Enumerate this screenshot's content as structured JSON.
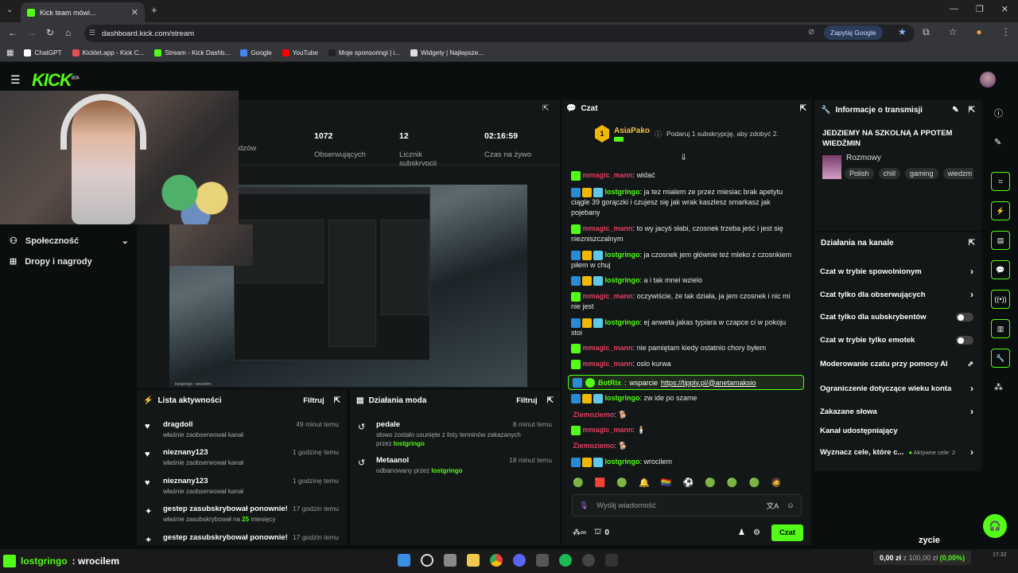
{
  "browser": {
    "tab_title": "Kick team mówi...",
    "url": "dashboard.kick.com/stream",
    "ask_google": "Zapytaj Google",
    "bookmarks": [
      {
        "label": "ChatGPT",
        "color": "#ffffff"
      },
      {
        "label": "Kicklet.app - Kick C...",
        "color": "#e05050"
      },
      {
        "label": "Stream - Kick Dashb...",
        "color": "#53fc18"
      },
      {
        "label": "Google",
        "color": "#4285f4"
      },
      {
        "label": "YouTube",
        "color": "#ff0000"
      },
      {
        "label": "Moje sponsoringi | i...",
        "color": "#222222"
      },
      {
        "label": "Widgety | Najlepsze...",
        "color": "#dddddd"
      }
    ]
  },
  "header": {
    "logo": "KICK",
    "logo_beta": "BETA"
  },
  "sidebar": {
    "items": [
      {
        "label": "Społeczność",
        "icon": "community-icon"
      },
      {
        "label": "Dropy i nagrody",
        "icon": "gift-icon"
      }
    ]
  },
  "stats": [
    {
      "value": "",
      "label": "dzów"
    },
    {
      "value": "1072",
      "label": "Obserwujących"
    },
    {
      "value": "12",
      "label": "Licznik subskrypcji"
    },
    {
      "value": "02:16:59",
      "label": "Czas na żywo"
    }
  ],
  "preview": {
    "caption": "lostgringo : wrocilem"
  },
  "activity": {
    "title": "Lista aktywności",
    "filter": "Filtruj",
    "items": [
      {
        "icon": "heart-icon",
        "name": "dragdoll",
        "time": "49 minut temu",
        "desc": "właśnie zaobserwował kanał",
        "highlight": "",
        "desc_after": ""
      },
      {
        "icon": "heart-icon",
        "name": "nieznany123",
        "time": "1 godzinę temu",
        "desc": "właśnie zaobserwował kanał",
        "highlight": "",
        "desc_after": ""
      },
      {
        "icon": "heart-icon",
        "name": "nieznany123",
        "time": "1 godzinę temu",
        "desc": "właśnie zaobserwował kanał",
        "highlight": "",
        "desc_after": ""
      },
      {
        "icon": "sparkle-icon",
        "name": "gestep zasubskrybował ponownie!",
        "time": "17 godzin temu",
        "desc": "właśnie zasubskrybował na",
        "highlight": "25",
        "desc_after": "miesięcy"
      },
      {
        "icon": "sparkle-icon",
        "name": "gestep zasubskrybował ponownie!",
        "time": "17 godzin temu",
        "desc": "",
        "highlight": "",
        "desc_after": ""
      }
    ]
  },
  "mod": {
    "title": "Działania moda",
    "filter": "Filtruj",
    "items": [
      {
        "name": "pedale",
        "time": "8 minut temu",
        "desc": "słowo zostało usunięte z listy terminów zakazanych",
        "desc2": "przez",
        "by": "lostgringo"
      },
      {
        "name": "Metaanol",
        "time": "18 minut temu",
        "desc": "odbanowany przez",
        "desc2": "",
        "by": "lostgringo"
      }
    ]
  },
  "chat": {
    "title": "Czat",
    "pinned_name": "AsiaPako",
    "pinned_level": "1",
    "pinned_text": "Podaruj 1 subskrypcję, aby zdobyć 2.",
    "messages": [
      {
        "user": "mmagic_mann",
        "color": "#e04060",
        "badges": [
          "#53fc18"
        ],
        "text": "widać"
      },
      {
        "user": "lostgringo",
        "color": "#53fc18",
        "badges": [
          "#2a8ad4",
          "#f2b705",
          "#5ec8e8"
        ],
        "text": "ja tez mialem ze przez miesiac brak apetytu ciągle 39 gorączki i czujesz się jak wrak kaszlesz smarkasz jak pojebany"
      },
      {
        "user": "mmagic_mann",
        "color": "#e04060",
        "badges": [
          "#53fc18"
        ],
        "text": "to wy jacyś słabi, czosnek trzeba jeść i jest się niezniszczalnym"
      },
      {
        "user": "lostgringo",
        "color": "#53fc18",
        "badges": [
          "#2a8ad4",
          "#f2b705",
          "#5ec8e8"
        ],
        "text": "ja czosnek jem głównie też mleko z czosnkiem piłem w chuj"
      },
      {
        "user": "lostgringo",
        "color": "#53fc18",
        "badges": [
          "#2a8ad4",
          "#f2b705",
          "#5ec8e8"
        ],
        "text": "a i tak mnei wzielo"
      },
      {
        "user": "mmagic_mann",
        "color": "#e04060",
        "badges": [
          "#53fc18"
        ],
        "text": "oczywiście, że tak działa, ja jem czosnek i nic mi nie jest"
      },
      {
        "user": "lostgringo",
        "color": "#53fc18",
        "badges": [
          "#2a8ad4",
          "#f2b705",
          "#5ec8e8"
        ],
        "text": "ej anweta jakas typiara w czapce ci w pokoju stoi"
      },
      {
        "user": "mmagic_mann",
        "color": "#e04060",
        "badges": [
          "#53fc18"
        ],
        "text": "nie pamiętam kiedy ostatnio chory byłem"
      },
      {
        "user": "mmagic_mann",
        "color": "#e04060",
        "badges": [
          "#53fc18"
        ],
        "text": "oslo kurwa"
      }
    ],
    "bot": {
      "user": "BotRix",
      "text": "wsparcie",
      "link": "https://tipply.pl/@anetamaksio"
    },
    "messages2": [
      {
        "user": "lostgringo",
        "color": "#53fc18",
        "badges": [
          "#2a8ad4",
          "#f2b705",
          "#5ec8e8"
        ],
        "text": "zw ide po szame"
      },
      {
        "user": "Ziemoziemo",
        "color": "#e04060",
        "badges": [],
        "text": "🐕"
      },
      {
        "user": "mmagic_mann",
        "color": "#e04060",
        "badges": [
          "#53fc18"
        ],
        "text": "🕯️"
      },
      {
        "user": "Ziemoziemo",
        "color": "#e04060",
        "badges": [],
        "text": "🐕"
      },
      {
        "user": "lostgringo",
        "color": "#53fc18",
        "badges": [
          "#2a8ad4",
          "#f2b705",
          "#5ec8e8"
        ],
        "text": "wrocilem"
      }
    ],
    "emotes": [
      "🟢",
      "🟥",
      "🟢",
      "🔔",
      "🏳️‍🌈",
      "⚽",
      "🟢",
      "🟢",
      "🟢",
      "🧔"
    ],
    "input_placeholder": "Wyślij wiadomość",
    "points": "0",
    "send_label": "Czat"
  },
  "info": {
    "title": "Informacje o transmisji",
    "stream_title": "JEDZIEMY NA SZKOLNĄ A PPOTEM WIEDŹMIN",
    "category": "Rozmowy",
    "tags": [
      "Polish",
      "chill",
      "gaming",
      "wiedzm"
    ]
  },
  "actions": {
    "title": "Działania na kanale",
    "items": [
      {
        "label": "Czat w trybie spowolnionym",
        "kind": "arrow"
      },
      {
        "label": "Czat tylko dla obserwujących",
        "kind": "arrow"
      },
      {
        "label": "Czat tylko dla subskrybentów",
        "kind": "toggle"
      },
      {
        "label": "Czat w trybie tylko emotek",
        "kind": "toggle"
      },
      {
        "label": "Moderowanie czatu przy pomocy AI",
        "kind": "external"
      },
      {
        "label": "Ograniczenie dotyczące wieku konta",
        "kind": "arrow"
      },
      {
        "label": "Zakazane słowa",
        "kind": "arrow"
      },
      {
        "label": "Kanał udostępniający",
        "kind": "none"
      },
      {
        "label": "Wyznacz cele, które c...",
        "kind": "goal",
        "extra": "Aktywne cele: 2"
      }
    ]
  },
  "overlay_text": "zycie",
  "taskbar": {
    "alert_user": "lostgringo",
    "alert_text": ": wrocilem",
    "finance": "0,00 zł",
    "finance_of": "z 100,00 zł",
    "finance_pct": "(0,00%)",
    "clock": "17:32"
  }
}
